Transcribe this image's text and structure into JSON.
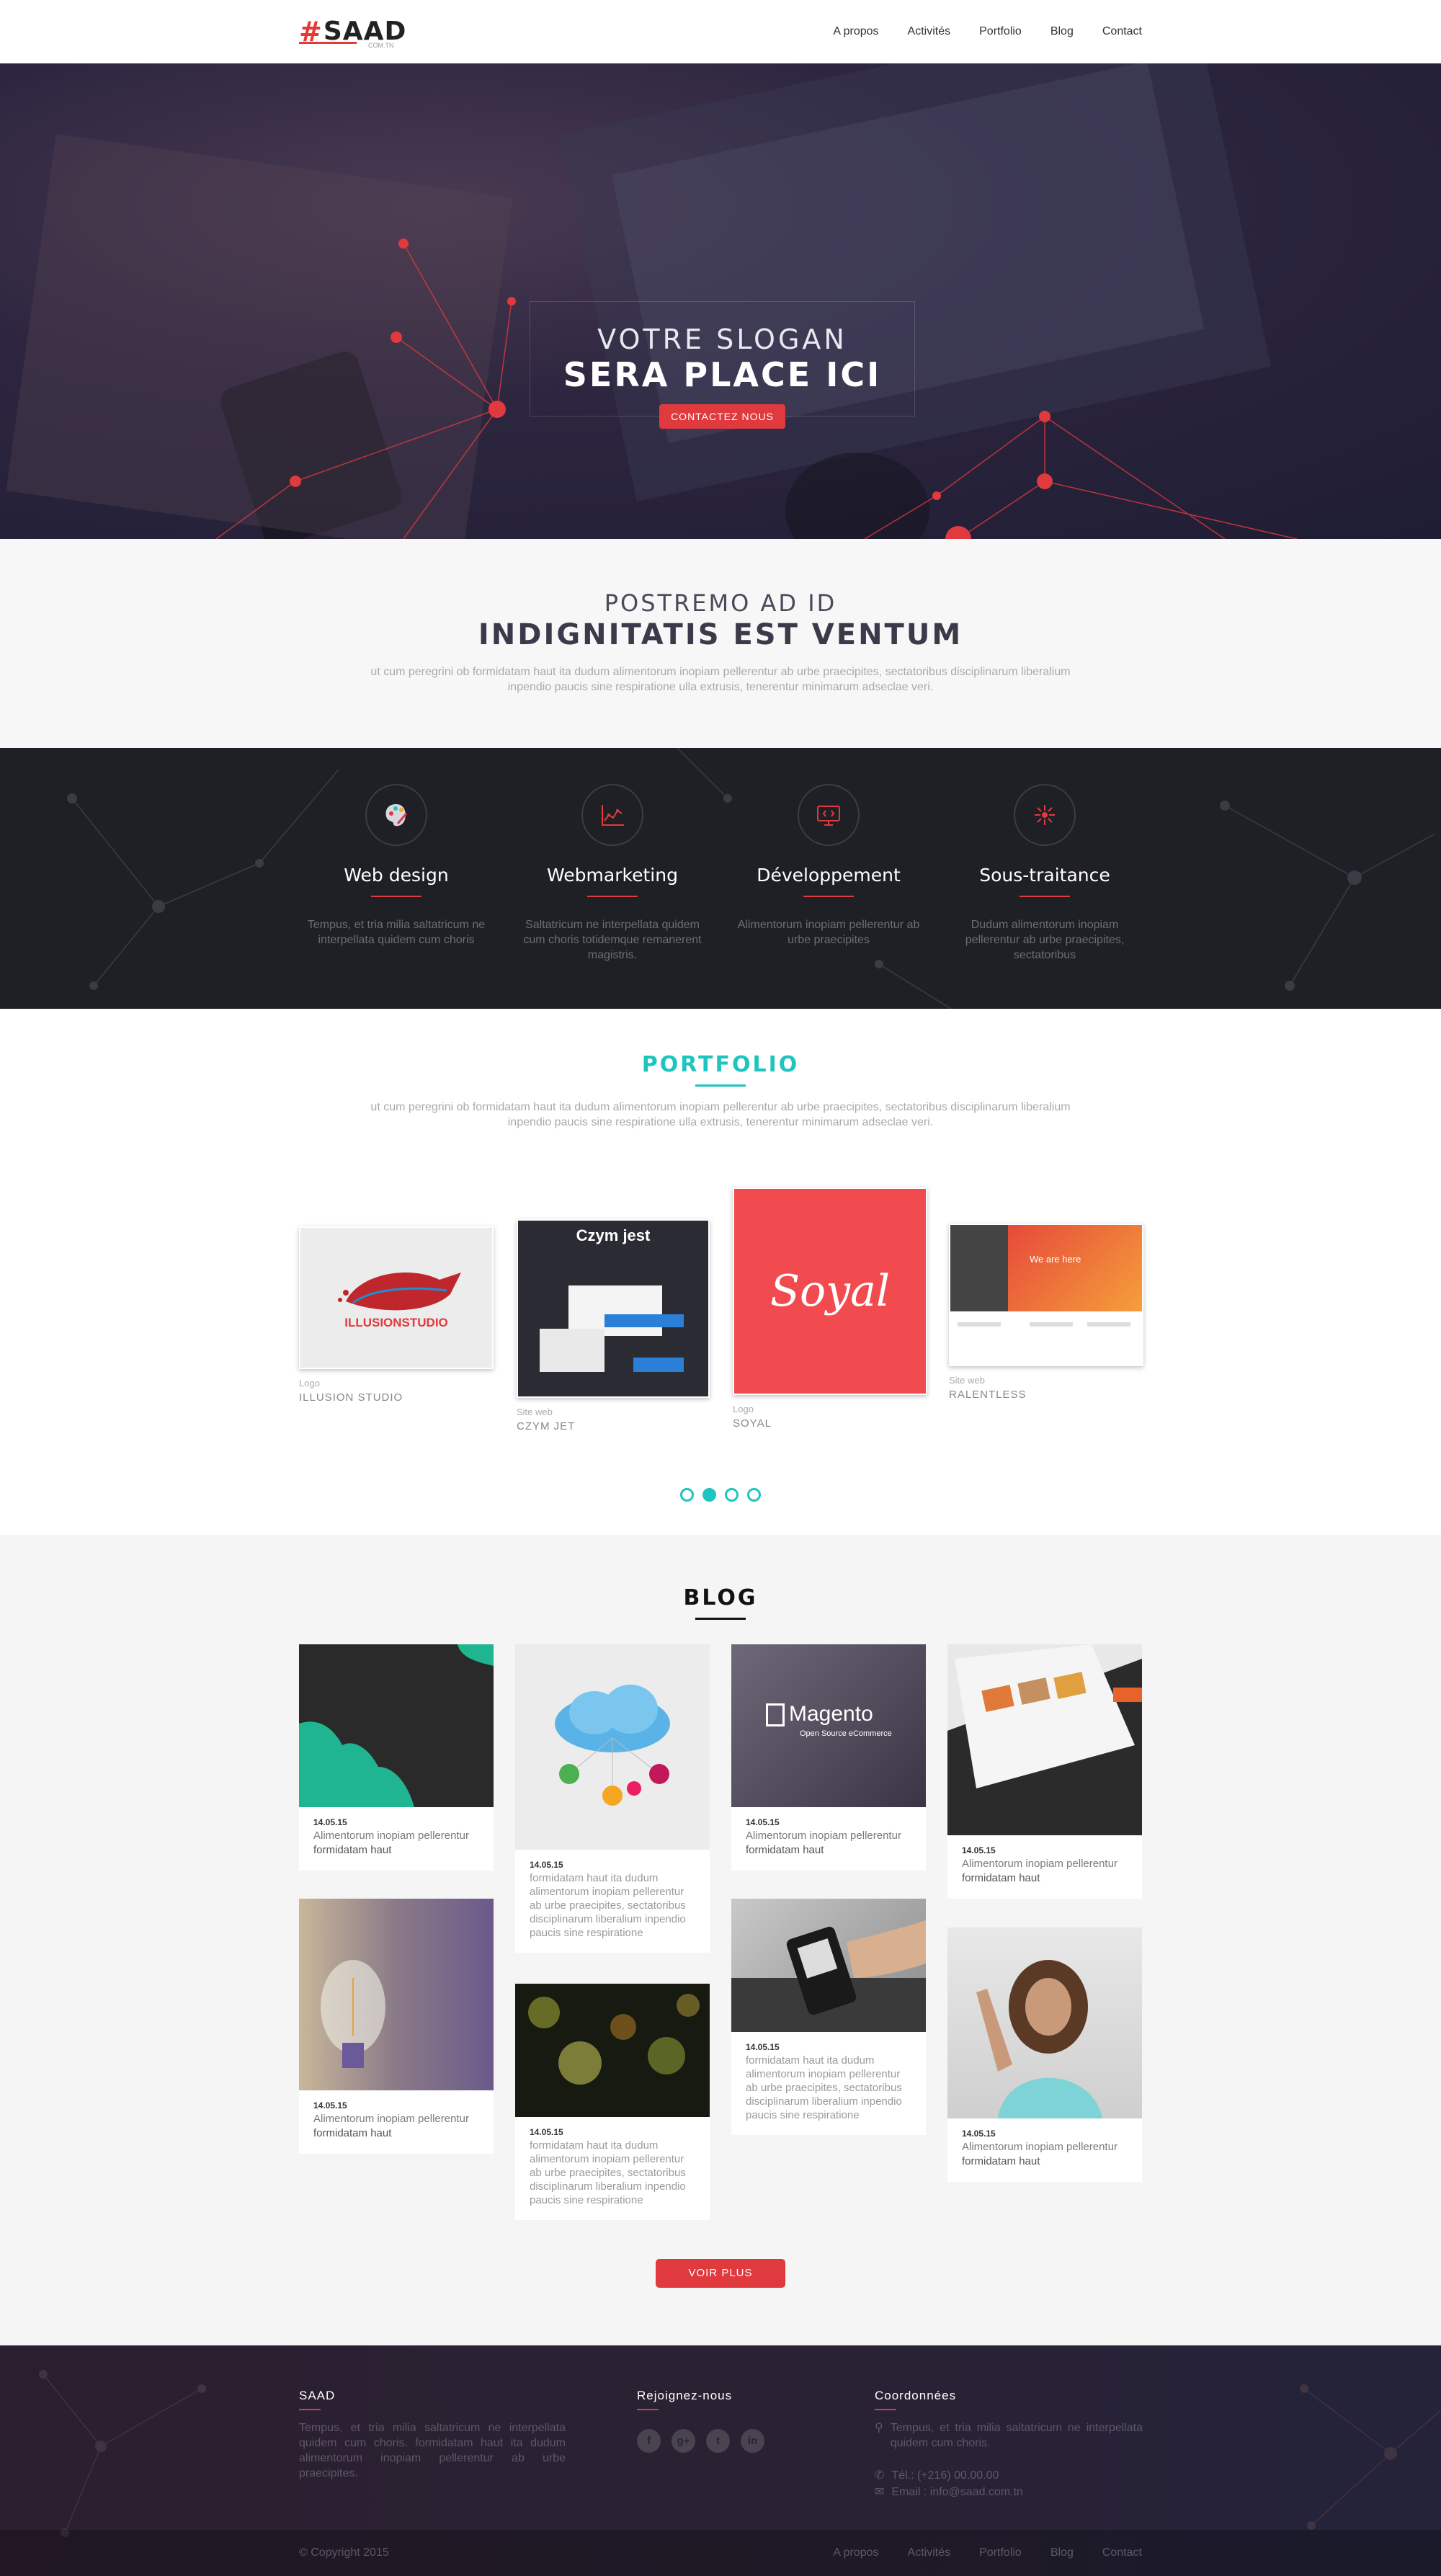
{
  "brand": {
    "logo_mark": "#",
    "logo_text": "SAAD",
    "logo_sub": "COM.TN",
    "accent": "#e0393e",
    "teal": "#1ec5c0"
  },
  "nav": {
    "items": [
      "A propos",
      "Activités",
      "Portfolio",
      "Blog",
      "Contact"
    ]
  },
  "hero": {
    "line1": "VOTRE SLOGAN",
    "line2": "SERA PLACE ICI",
    "button": "CONTACTEZ NOUS"
  },
  "intro": {
    "line1": "POSTREMO AD ID",
    "line2": "INDIGNITATIS EST VENTUM",
    "text": "ut cum peregrini ob formidatam haut ita dudum alimentorum inopiam pellerentur ab urbe praecipites, sectatoribus disciplinarum liberalium inpendio paucis sine respiratione ulla extrusis, tenerentur minimarum adseclae veri."
  },
  "services": [
    {
      "icon": "palette-icon",
      "title": "Web design",
      "text": "Tempus, et tria milia saltatricum ne interpellata quidem cum choris"
    },
    {
      "icon": "chart-icon",
      "title": "Webmarketing",
      "text": "Saltatricum ne interpellata quidem cum choris totidemque remanerent magistris."
    },
    {
      "icon": "monitor-code-icon",
      "title": "Développement",
      "text": "Alimentorum inopiam pellerentur ab urbe praecipites"
    },
    {
      "icon": "network-icon",
      "title": "Sous-traitance",
      "text": "Dudum alimentorum inopiam pellerentur ab urbe praecipites, sectatoribus"
    }
  ],
  "portfolio": {
    "title": "PORTFOLIO",
    "text": "ut cum peregrini ob formidatam haut ita dudum alimentorum inopiam pellerentur ab urbe praecipites, sectatoribus disciplinarum liberalium inpendio paucis sine respiratione ulla extrusis, tenerentur minimarum adseclae veri.",
    "items": [
      {
        "category": "Logo",
        "name": "ILLUSION STUDIO",
        "image_text": "ILLUSIONSTUDIO"
      },
      {
        "category": "Site web",
        "name": "CZYM JET",
        "image_text": "Czym jest"
      },
      {
        "category": "Logo",
        "name": "SOYAL",
        "image_text": "Soyal"
      },
      {
        "category": "Site web",
        "name": "RALENTLESS",
        "image_text": "We are here"
      }
    ],
    "active_slide": 2
  },
  "blog": {
    "title": "BLOG",
    "cards": [
      {
        "date": "14.05.15",
        "text": "Alimentorum inopiam pellerentur",
        "sub": "formidatam haut"
      },
      {
        "date": "14.05.15",
        "text": "formidatam haut ita dudum alimentorum inopiam pellerentur ab urbe praecipites, sectatoribus disciplinarum liberalium inpendio paucis sine respiratione"
      },
      {
        "date": "14.05.15",
        "text": "Alimentorum inopiam pellerentur",
        "sub": "formidatam haut",
        "image_text": "Magento",
        "image_sub": "Open Source eCommerce"
      },
      {
        "date": "14.05.15",
        "text": "Alimentorum inopiam pellerentur",
        "sub": "formidatam haut"
      },
      {
        "date": "14.05.15",
        "text": "Alimentorum inopiam pellerentur",
        "sub": "formidatam haut"
      },
      {
        "date": "14.05.15",
        "text": "formidatam haut ita dudum alimentorum inopiam pellerentur ab urbe praecipites, sectatoribus disciplinarum liberalium inpendio paucis sine respiratione"
      },
      {
        "date": "14.05.15",
        "text": "formidatam haut ita dudum alimentorum inopiam pellerentur ab urbe praecipites, sectatoribus disciplinarum liberalium inpendio paucis sine respiratione"
      },
      {
        "date": "14.05.15",
        "text": "Alimentorum inopiam pellerentur",
        "sub": "formidatam haut"
      }
    ],
    "more_button": "VOIR PLUS"
  },
  "footer": {
    "about_title": "SAAD",
    "about_text": "Tempus, et tria milia saltatricum ne interpellata quidem cum choris. formidatam haut ita dudum alimentorum inopiam pellerentur ab urbe praecipites.",
    "social_title": "Rejoignez-nous",
    "social": [
      "facebook-icon",
      "google-plus-icon",
      "twitter-icon",
      "linkedin-icon"
    ],
    "contact_title": "Coordonnées",
    "address": "Tempus, et tria milia saltatricum ne interpellata quidem cum choris.",
    "phone": "Tél.: (+216) 00.00.00",
    "email": "Email : info@saad.com.tn",
    "copyright": "© Copyright 2015",
    "nav": [
      "A propos",
      "Activités",
      "Portfolio",
      "Blog",
      "Contact"
    ]
  }
}
